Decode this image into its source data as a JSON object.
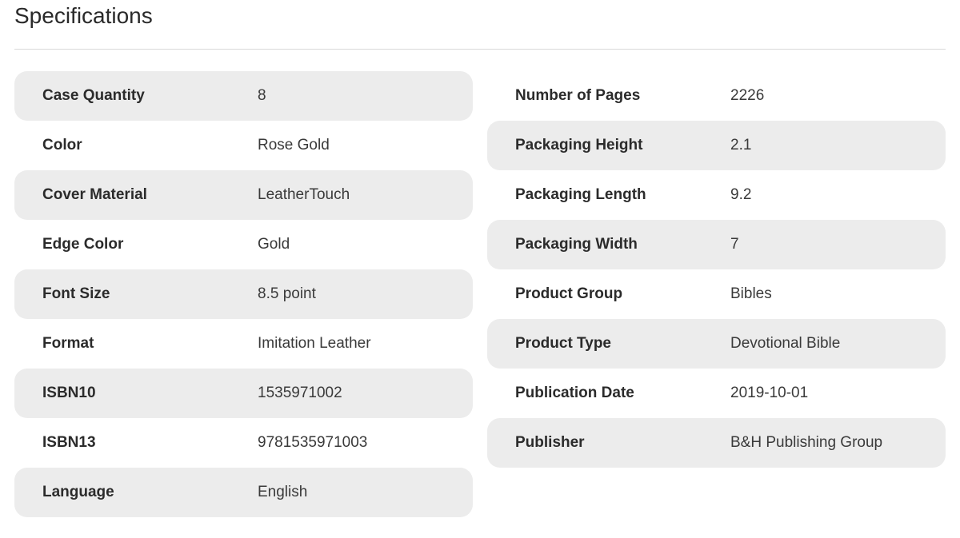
{
  "title": "Specifications",
  "left_specs": [
    {
      "label": "Case Quantity",
      "value": "8"
    },
    {
      "label": "Color",
      "value": "Rose Gold"
    },
    {
      "label": "Cover Material",
      "value": "LeatherTouch"
    },
    {
      "label": "Edge Color",
      "value": "Gold"
    },
    {
      "label": "Font Size",
      "value": "8.5 point"
    },
    {
      "label": "Format",
      "value": "Imitation Leather"
    },
    {
      "label": "ISBN10",
      "value": "1535971002"
    },
    {
      "label": "ISBN13",
      "value": "9781535971003"
    },
    {
      "label": "Language",
      "value": "English"
    }
  ],
  "right_specs": [
    {
      "label": "Number of Pages",
      "value": "2226"
    },
    {
      "label": "Packaging Height",
      "value": "2.1"
    },
    {
      "label": "Packaging Length",
      "value": "9.2"
    },
    {
      "label": "Packaging Width",
      "value": "7"
    },
    {
      "label": "Product Group",
      "value": "Bibles"
    },
    {
      "label": "Product Type",
      "value": "Devotional Bible"
    },
    {
      "label": "Publication Date",
      "value": "2019-10-01"
    },
    {
      "label": "Publisher",
      "value": "B&H Publishing Group"
    }
  ],
  "colors": {
    "row_shade": "#ececec",
    "divider": "#d8d8d8"
  }
}
